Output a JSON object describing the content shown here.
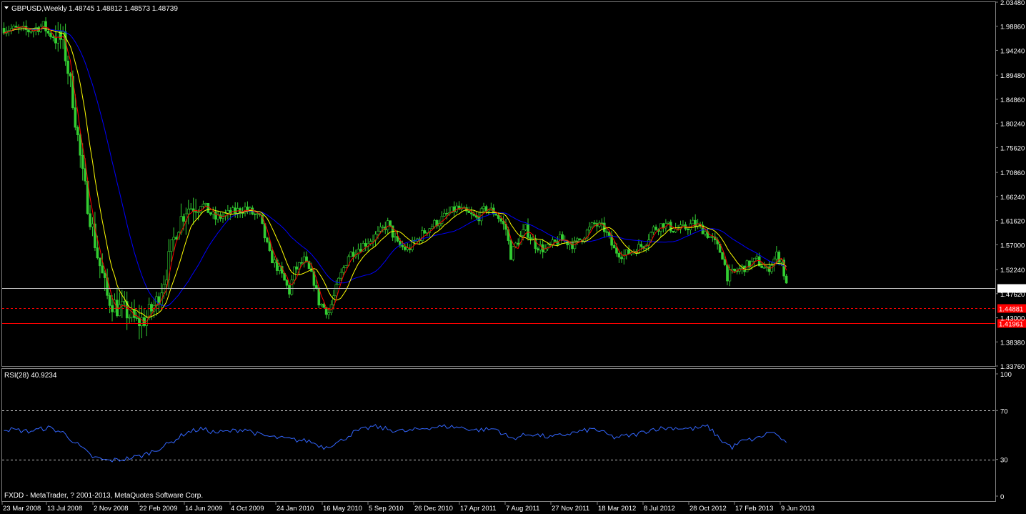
{
  "chart_data": [
    {
      "type": "candlestick",
      "title": "GBPUSD,Weekly",
      "ohlc_readout": "1.48745 1.48812 1.48573 1.48739",
      "y_range": [
        1.3376,
        2.0348
      ],
      "y_ticks": [
        "2.03480",
        "1.98860",
        "1.94240",
        "1.89480",
        "1.84860",
        "1.80240",
        "1.75620",
        "1.70860",
        "1.66240",
        "1.61620",
        "1.57000",
        "1.52240",
        "1.47620",
        "1.43000",
        "1.38380",
        "1.33760"
      ],
      "x_ticks": [
        "23 Mar 2008",
        "13 Jul 2008",
        "2 Nov 2008",
        "22 Feb 2009",
        "14 Jun 2009",
        "4 Oct 2009",
        "24 Jan 2010",
        "16 May 2010",
        "5 Sep 2010",
        "26 Dec 2010",
        "17 Apr 2011",
        "7 Aug 2011",
        "27 Nov 2011",
        "18 Mar 2012",
        "8 Jul 2012",
        "28 Oct 2012",
        "17 Feb 2013",
        "9 Jun 2013"
      ],
      "price_path": [
        [
          0,
          1.985
        ],
        [
          10,
          1.98
        ],
        [
          16,
          1.99
        ],
        [
          18,
          1.975
        ],
        [
          24,
          1.96
        ],
        [
          28,
          1.85
        ],
        [
          32,
          1.7
        ],
        [
          38,
          1.55
        ],
        [
          42,
          1.47
        ],
        [
          46,
          1.45
        ],
        [
          50,
          1.44
        ],
        [
          54,
          1.42
        ],
        [
          58,
          1.43
        ],
        [
          62,
          1.46
        ],
        [
          66,
          1.52
        ],
        [
          70,
          1.6
        ],
        [
          74,
          1.64
        ],
        [
          80,
          1.65
        ],
        [
          86,
          1.62
        ],
        [
          92,
          1.63
        ],
        [
          98,
          1.64
        ],
        [
          104,
          1.62
        ],
        [
          108,
          1.55
        ],
        [
          112,
          1.52
        ],
        [
          116,
          1.48
        ],
        [
          118,
          1.52
        ],
        [
          122,
          1.54
        ],
        [
          126,
          1.5
        ],
        [
          128,
          1.46
        ],
        [
          132,
          1.44
        ],
        [
          136,
          1.5
        ],
        [
          140,
          1.55
        ],
        [
          146,
          1.57
        ],
        [
          152,
          1.59
        ],
        [
          156,
          1.61
        ],
        [
          160,
          1.57
        ],
        [
          164,
          1.56
        ],
        [
          168,
          1.58
        ],
        [
          172,
          1.6
        ],
        [
          178,
          1.62
        ],
        [
          184,
          1.64
        ],
        [
          188,
          1.63
        ],
        [
          192,
          1.62
        ],
        [
          196,
          1.64
        ],
        [
          200,
          1.63
        ],
        [
          204,
          1.6
        ],
        [
          206,
          1.55
        ],
        [
          208,
          1.57
        ],
        [
          212,
          1.6
        ],
        [
          216,
          1.57
        ],
        [
          220,
          1.56
        ],
        [
          226,
          1.58
        ],
        [
          232,
          1.57
        ],
        [
          236,
          1.59
        ],
        [
          240,
          1.61
        ],
        [
          244,
          1.6
        ],
        [
          248,
          1.56
        ],
        [
          252,
          1.55
        ],
        [
          256,
          1.56
        ],
        [
          260,
          1.57
        ],
        [
          264,
          1.6
        ],
        [
          268,
          1.61
        ],
        [
          272,
          1.6
        ],
        [
          276,
          1.6
        ],
        [
          280,
          1.61
        ],
        [
          284,
          1.6
        ],
        [
          288,
          1.58
        ],
        [
          292,
          1.55
        ],
        [
          294,
          1.51
        ],
        [
          298,
          1.52
        ],
        [
          302,
          1.53
        ],
        [
          306,
          1.54
        ],
        [
          310,
          1.52
        ],
        [
          314,
          1.55
        ],
        [
          316,
          1.54
        ],
        [
          318,
          1.49
        ]
      ],
      "ma_red_period_label": "",
      "horizontal_levels": [
        {
          "price": 1.48739,
          "label": "1.48739",
          "color": "#c0c0c0",
          "style": "solid",
          "label_bg": "#ffffff",
          "label_fg": "#000000"
        },
        {
          "price": 1.44881,
          "label": "1.44881",
          "color": "#ff0000",
          "style": "dashed",
          "label_bg": "#ff0000",
          "label_fg": "#000000"
        },
        {
          "price": 1.41961,
          "label": "1.41961",
          "color": "#ff0000",
          "style": "solid",
          "label_bg": "#ff0000",
          "label_fg": "#000000"
        }
      ],
      "colors": {
        "candles": "#32cd32",
        "ma_fast": "#ff0000",
        "ma_mid": "#ffff00",
        "ma_slow": "#0000ff",
        "grid": "#808080",
        "background": "#000000"
      }
    },
    {
      "type": "line",
      "title": "RSI(28) 40.9234",
      "y_range": [
        0,
        100
      ],
      "y_ticks": [
        "100",
        "70",
        "30",
        "0"
      ],
      "levels": [
        70,
        30
      ],
      "rsi_path": [
        [
          0,
          55
        ],
        [
          10,
          53
        ],
        [
          18,
          56
        ],
        [
          24,
          52
        ],
        [
          30,
          42
        ],
        [
          36,
          32
        ],
        [
          42,
          29
        ],
        [
          48,
          30
        ],
        [
          56,
          33
        ],
        [
          62,
          38
        ],
        [
          68,
          44
        ],
        [
          74,
          52
        ],
        [
          80,
          55
        ],
        [
          86,
          52
        ],
        [
          92,
          53
        ],
        [
          98,
          55
        ],
        [
          104,
          50
        ],
        [
          110,
          48
        ],
        [
          118,
          46
        ],
        [
          124,
          45
        ],
        [
          130,
          40
        ],
        [
          136,
          44
        ],
        [
          142,
          52
        ],
        [
          150,
          57
        ],
        [
          158,
          54
        ],
        [
          164,
          53
        ],
        [
          172,
          56
        ],
        [
          180,
          57
        ],
        [
          186,
          56
        ],
        [
          192,
          54
        ],
        [
          200,
          55
        ],
        [
          206,
          47
        ],
        [
          214,
          51
        ],
        [
          222,
          48
        ],
        [
          232,
          52
        ],
        [
          240,
          55
        ],
        [
          248,
          48
        ],
        [
          256,
          50
        ],
        [
          264,
          55
        ],
        [
          272,
          56
        ],
        [
          280,
          55
        ],
        [
          286,
          57
        ],
        [
          292,
          45
        ],
        [
          296,
          40
        ],
        [
          300,
          45
        ],
        [
          306,
          47
        ],
        [
          312,
          53
        ],
        [
          316,
          47
        ],
        [
          318,
          42
        ]
      ],
      "color": "#3366ff"
    }
  ],
  "footer": {
    "copyright": "FXDD - MetaTrader, ? 2001-2013, MetaQuotes Software Corp."
  }
}
